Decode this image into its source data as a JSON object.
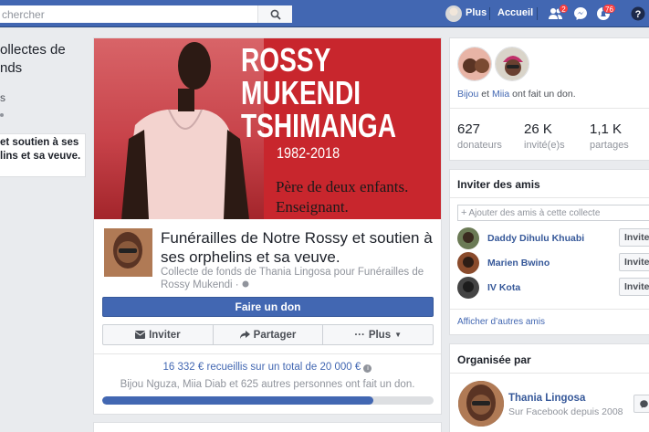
{
  "topbar": {
    "search_placeholder": "chercher",
    "more_label": "Plus",
    "home_label": "Accueil",
    "friend_requests_badge": "2",
    "notifications_badge": "76"
  },
  "left": {
    "title": "ollectes de nds",
    "item1": "s",
    "active_item": "et soutien à ses lins et sa veuve."
  },
  "cover": {
    "name_line1": "ROSSY",
    "name_line2": "MUKENDI",
    "name_line3": "TSHIMANGA",
    "years": "1982-2018",
    "tag_line1": "Père de deux enfants.",
    "tag_line2": "Enseignant."
  },
  "fundraiser": {
    "title": "Funérailles de Notre Rossy et soutien à ses orphelins et sa veuve.",
    "subtitle": "Collecte de fonds de Thania Lingosa pour Funérailles de Rossy Mukendi · ",
    "donate_label": "Faire un don",
    "invite_label": "Inviter",
    "share_label": "Partager",
    "more_label": "Plus",
    "raised_text": "16 332 € recueillis sur un total de 20 000 €",
    "donors_text": "Bijou Nguza, Miia Diab et 625 autres personnes ont fait un don.",
    "progress": 0.817
  },
  "donors_card": {
    "name1": "Bijou",
    "and": " et ",
    "name2": "Miia",
    "suffix": " ont fait un don.",
    "stats": [
      {
        "value": "627",
        "label": "donateurs"
      },
      {
        "value": "26 K",
        "label": "invité(e)s"
      },
      {
        "value": "1,1 K",
        "label": "partages"
      }
    ]
  },
  "invite_card": {
    "title": "Inviter des amis",
    "input_placeholder": "Ajouter des amis à cette collecte",
    "friends": [
      {
        "name": "Daddy Dihulu Khuabi",
        "button": "Inviter"
      },
      {
        "name": "Marien Bwino",
        "button": "Inviter"
      },
      {
        "name": "IV Kota",
        "button": "Inviter"
      }
    ],
    "show_more": "Afficher d’autres amis"
  },
  "organizer_card": {
    "title": "Organisée par",
    "name": "Thania Lingosa",
    "since": "Sur Facebook depuis 2008"
  },
  "colors": {
    "brand": "#4267b2",
    "cover_red": "#c8262d"
  }
}
